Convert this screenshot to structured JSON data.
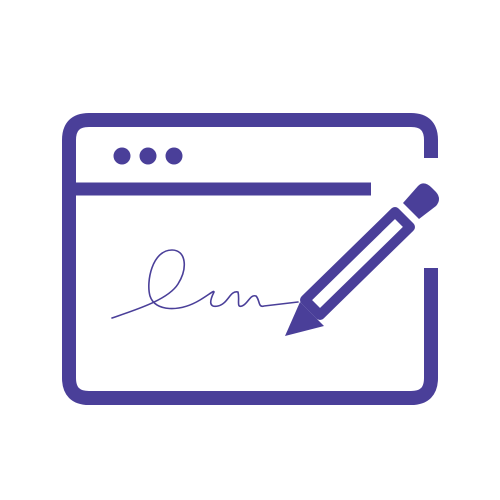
{
  "icon": {
    "name": "browser-window-with-signature-icon",
    "color": "#4a3f99",
    "background": "#ffffff",
    "parts": [
      "browser-window-frame-icon",
      "window-dots-icon",
      "title-bar-divider",
      "signature-scribble-icon",
      "pencil-icon"
    ]
  }
}
